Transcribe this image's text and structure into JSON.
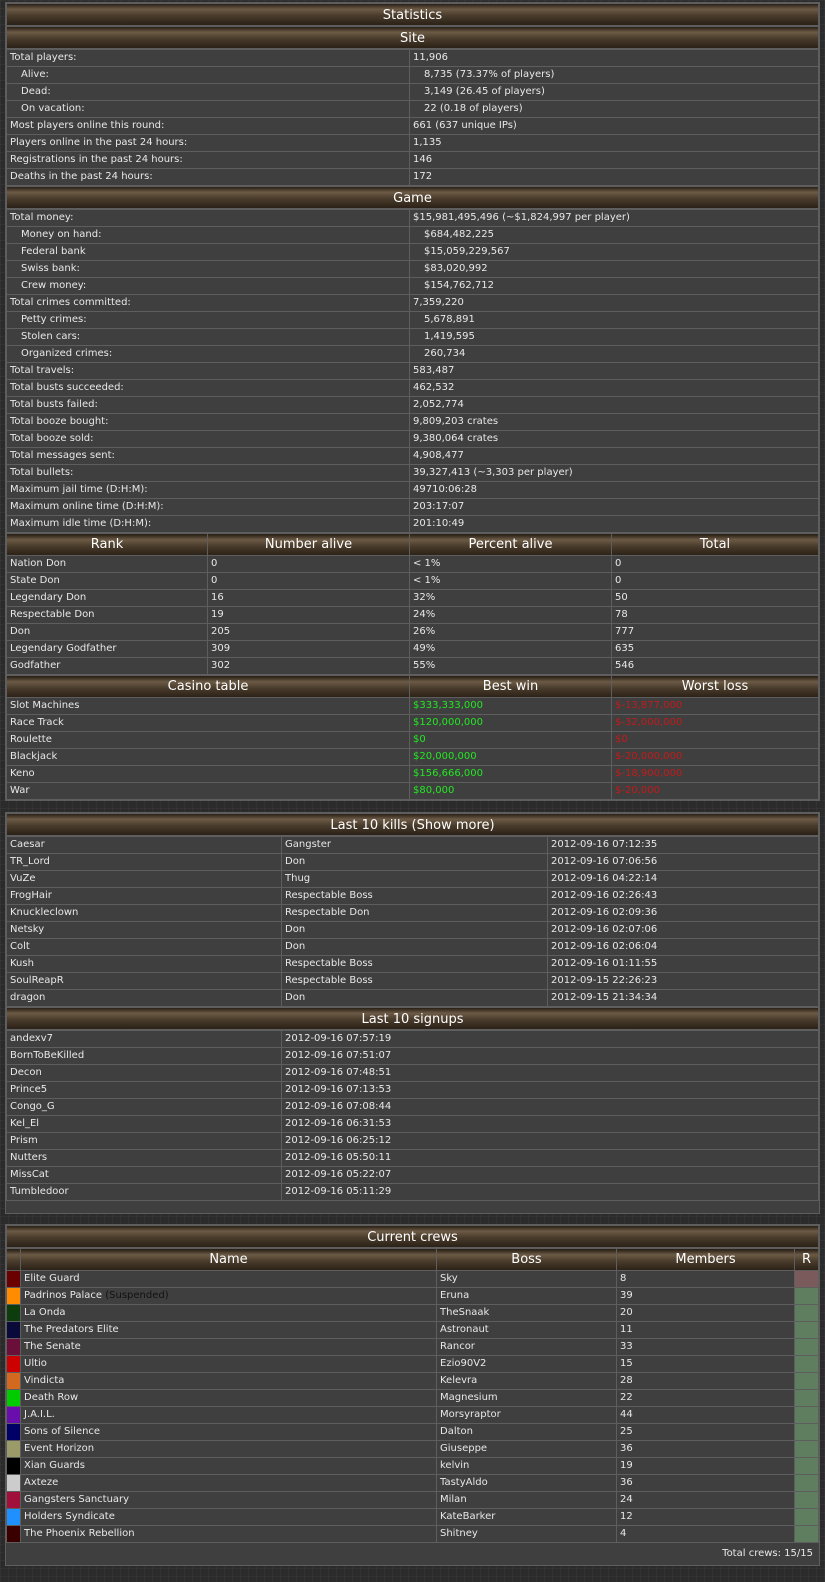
{
  "stats": {
    "title": "Statistics",
    "site": {
      "title": "Site",
      "rows": [
        {
          "label": "Total players:",
          "value": "11,906",
          "indent": false
        },
        {
          "label": "Alive:",
          "value": "8,735 (73.37% of players)",
          "indent": true
        },
        {
          "label": "Dead:",
          "value": "3,149 (26.45 of players)",
          "indent": true
        },
        {
          "label": "On vacation:",
          "value": "22 (0.18 of players)",
          "indent": true
        },
        {
          "label": "Most players online this round:",
          "value": "661 (637 unique IPs)",
          "indent": false
        },
        {
          "label": "Players online in the past 24 hours:",
          "value": "1,135",
          "indent": false
        },
        {
          "label": "Registrations in the past 24 hours:",
          "value": "146",
          "indent": false
        },
        {
          "label": "Deaths in the past 24 hours:",
          "value": "172",
          "indent": false
        }
      ]
    },
    "game": {
      "title": "Game",
      "rows": [
        {
          "label": "Total money:",
          "value": "$15,981,495,496 (~$1,824,997 per player)",
          "indent": false
        },
        {
          "label": "Money on hand:",
          "value": "$684,482,225",
          "indent": true
        },
        {
          "label": "Federal bank",
          "value": "$15,059,229,567",
          "indent": true
        },
        {
          "label": "Swiss bank:",
          "value": "$83,020,992",
          "indent": true
        },
        {
          "label": "Crew money:",
          "value": "$154,762,712",
          "indent": true
        },
        {
          "label": "Total crimes committed:",
          "value": "7,359,220",
          "indent": false
        },
        {
          "label": "Petty crimes:",
          "value": "5,678,891",
          "indent": true
        },
        {
          "label": "Stolen cars:",
          "value": "1,419,595",
          "indent": true
        },
        {
          "label": "Organized crimes:",
          "value": "260,734",
          "indent": true
        },
        {
          "label": "Total travels:",
          "value": "583,487",
          "indent": false
        },
        {
          "label": "Total busts succeeded:",
          "value": "462,532",
          "indent": false
        },
        {
          "label": "Total busts failed:",
          "value": "2,052,774",
          "indent": false
        },
        {
          "label": "Total booze bought:",
          "value": "9,809,203 crates",
          "indent": false
        },
        {
          "label": "Total booze sold:",
          "value": "9,380,064 crates",
          "indent": false
        },
        {
          "label": "Total messages sent:",
          "value": "4,908,477",
          "indent": false
        },
        {
          "label": "Total bullets:",
          "value": "39,327,413 (~3,303 per player)",
          "indent": false
        },
        {
          "label": "Maximum jail time (D:H:M):",
          "value": "49710:06:28",
          "indent": false
        },
        {
          "label": "Maximum online time (D:H:M):",
          "value": "203:17:07",
          "indent": false
        },
        {
          "label": "Maximum idle time (D:H:M):",
          "value": "201:10:49",
          "indent": false
        }
      ]
    },
    "rank": {
      "headers": [
        "Rank",
        "Number alive",
        "Percent alive",
        "Total"
      ],
      "rows": [
        [
          "Nation Don",
          "0",
          "< 1%",
          "0"
        ],
        [
          "State Don",
          "0",
          "< 1%",
          "0"
        ],
        [
          "Legendary Don",
          "16",
          "32%",
          "50"
        ],
        [
          "Respectable Don",
          "19",
          "24%",
          "78"
        ],
        [
          "Don",
          "205",
          "26%",
          "777"
        ],
        [
          "Legendary Godfather",
          "309",
          "49%",
          "635"
        ],
        [
          "Godfather",
          "302",
          "55%",
          "546"
        ]
      ]
    },
    "casino": {
      "headers": [
        "Casino table",
        "Best win",
        "Worst loss"
      ],
      "rows": [
        [
          "Slot Machines",
          "$333,333,000",
          "$-13,877,000"
        ],
        [
          "Race Track",
          "$120,000,000",
          "$-32,000,000"
        ],
        [
          "Roulette",
          "$0",
          "$0"
        ],
        [
          "Blackjack",
          "$20,000,000",
          "$-20,000,000"
        ],
        [
          "Keno",
          "$156,666,000",
          "$-18,900,000"
        ],
        [
          "War",
          "$80,000",
          "$-20,000"
        ]
      ]
    }
  },
  "kills": {
    "title": "Last 10 kills (Show more)",
    "rows": [
      [
        "Caesar",
        "Gangster",
        "2012-09-16 07:12:35"
      ],
      [
        "TR_Lord",
        "Don",
        "2012-09-16 07:06:56"
      ],
      [
        "VuZe",
        "Thug",
        "2012-09-16 04:22:14"
      ],
      [
        "FrogHair",
        "Respectable Boss",
        "2012-09-16 02:26:43"
      ],
      [
        "Knuckleclown",
        "Respectable Don",
        "2012-09-16 02:09:36"
      ],
      [
        "Netsky",
        "Don",
        "2012-09-16 02:07:06"
      ],
      [
        "Colt",
        "Don",
        "2012-09-16 02:06:04"
      ],
      [
        "Kush",
        "Respectable Boss",
        "2012-09-16 01:11:55"
      ],
      [
        "SoulReapR",
        "Respectable Boss",
        "2012-09-15 22:26:23"
      ],
      [
        "dragon",
        "Don",
        "2012-09-15 21:34:34"
      ]
    ]
  },
  "signups": {
    "title": "Last 10 signups",
    "rows": [
      [
        "andexv7",
        "2012-09-16 07:57:19"
      ],
      [
        "BornToBeKilled",
        "2012-09-16 07:51:07"
      ],
      [
        "Decon",
        "2012-09-16 07:48:51"
      ],
      [
        "Prince5",
        "2012-09-16 07:13:53"
      ],
      [
        "Congo_G",
        "2012-09-16 07:08:44"
      ],
      [
        "Kel_El",
        "2012-09-16 06:31:53"
      ],
      [
        "Prism",
        "2012-09-16 06:25:12"
      ],
      [
        "Nutters",
        "2012-09-16 05:50:11"
      ],
      [
        "MissCat",
        "2012-09-16 05:22:07"
      ],
      [
        "Tumbledoor",
        "2012-09-16 05:11:29"
      ]
    ]
  },
  "crews": {
    "title": "Current crews",
    "headers": [
      "",
      "Name",
      "Boss",
      "Members",
      "R"
    ],
    "rows": [
      {
        "color": "#6b0000",
        "name": "Elite Guard",
        "note": "",
        "boss": "Sky",
        "members": "8",
        "r": "#7a5a5a"
      },
      {
        "color": "#ff8c00",
        "name": "Padrinos Palace",
        "note": "(Suspended)",
        "boss": "Eruna",
        "members": "39",
        "r": "#5f7d5f"
      },
      {
        "color": "#0d3d0d",
        "name": "La Onda",
        "note": "",
        "boss": "TheSnaak",
        "members": "20",
        "r": "#5f7d5f"
      },
      {
        "color": "#0a0a3a",
        "name": "The Predators Elite",
        "note": "",
        "boss": "Astronaut",
        "members": "11",
        "r": "#5f7d5f"
      },
      {
        "color": "#6a0f3a",
        "name": "The Senate",
        "note": "",
        "boss": "Rancor",
        "members": "33",
        "r": "#5f7d5f"
      },
      {
        "color": "#cc0000",
        "name": "Ultio",
        "note": "",
        "boss": "Ezio90V2",
        "members": "15",
        "r": "#5f7d5f"
      },
      {
        "color": "#d2691e",
        "name": "Vindicta",
        "note": "",
        "boss": "Kelevra",
        "members": "28",
        "r": "#5f7d5f"
      },
      {
        "color": "#00cc00",
        "name": "Death Row",
        "note": "",
        "boss": "Magnesium",
        "members": "22",
        "r": "#5f7d5f"
      },
      {
        "color": "#6a0dad",
        "name": "J.A.I.L.",
        "note": "",
        "boss": "Morsyraptor",
        "members": "44",
        "r": "#5f7d5f"
      },
      {
        "color": "#000066",
        "name": "Sons of Silence",
        "note": "",
        "boss": "Dalton",
        "members": "25",
        "r": "#5f7d5f"
      },
      {
        "color": "#9b9b6a",
        "name": "Event Horizon",
        "note": "",
        "boss": "Giuseppe",
        "members": "36",
        "r": "#5f7d5f"
      },
      {
        "color": "#000000",
        "name": "Xian Guards",
        "note": "",
        "boss": "kelvin",
        "members": "19",
        "r": "#5f7d5f"
      },
      {
        "color": "#cccccc",
        "name": "Axteze",
        "note": "",
        "boss": "TastyAldo",
        "members": "36",
        "r": "#5f7d5f"
      },
      {
        "color": "#a0103a",
        "name": "Gangsters Sanctuary",
        "note": "",
        "boss": "Milan",
        "members": "24",
        "r": "#5f7d5f"
      },
      {
        "color": "#1e90ff",
        "name": "Holders Syndicate",
        "note": "",
        "boss": "KateBarker",
        "members": "12",
        "r": "#5f7d5f"
      },
      {
        "color": "#3a0000",
        "name": "The Phoenix Rebellion",
        "note": "",
        "boss": "Shitney",
        "members": "4",
        "r": "#5f7d5f"
      }
    ],
    "total_label": "Total crews: 15/15"
  }
}
